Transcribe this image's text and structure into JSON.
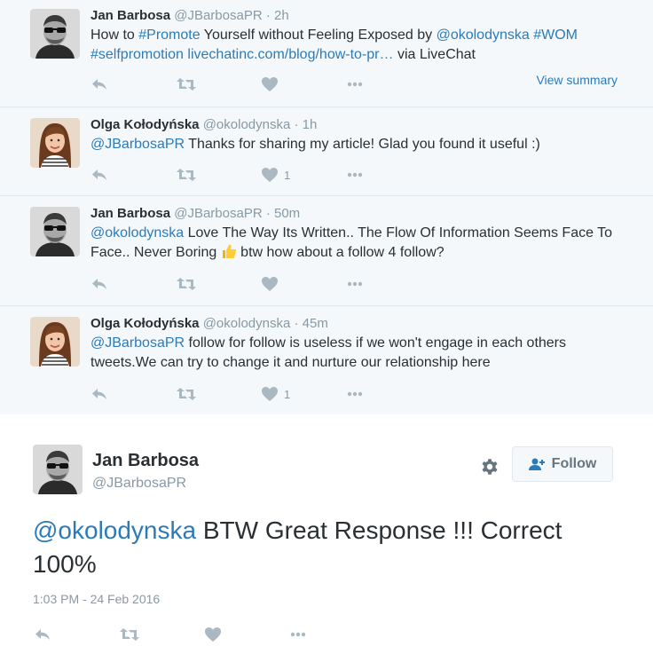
{
  "thread": [
    {
      "name": "Jan Barbosa",
      "handle": "@JBarbosaPR",
      "time": "· 2h",
      "text_parts": [
        "How to ",
        "#Promote",
        " Yourself without Feeling Exposed by ",
        "@okolodynska",
        " ",
        "#WOM",
        "#selfpromotion",
        " ",
        "livechatinc.com/blog/how-to-pr…",
        " via LiveChat"
      ],
      "view_summary": "View summary",
      "like_count": ""
    },
    {
      "name": "Olga Kołodyńska",
      "handle": "@okolodynska",
      "time": "· 1h",
      "text_parts": [
        "@JBarbosaPR",
        " Thanks for sharing my article! Glad you found it useful :)"
      ],
      "like_count": "1"
    },
    {
      "name": "Jan Barbosa",
      "handle": "@JBarbosaPR",
      "time": "· 50m",
      "text_parts": [
        "@okolodynska",
        " Love The Way Its Written.. The Flow Of Information Seems Face To Face.. Never Boring ",
        " btw how about a follow 4 follow?"
      ],
      "like_count": ""
    },
    {
      "name": "Olga Kołodyńska",
      "handle": "@okolodynska",
      "time": "· 45m",
      "text_parts": [
        "@JBarbosaPR",
        " follow for follow is useless if we won't engage in each others tweets.We can try to change it and nurture our relationship here"
      ],
      "like_count": "1"
    }
  ],
  "main_tweet": {
    "name": "Jan Barbosa",
    "handle": "@JBarbosaPR",
    "follow_label": "Follow",
    "mention": "@okolodynska",
    "text": " BTW Great Response !!! Correct 100%",
    "datetime": "1:03 PM - 24 Feb 2016"
  },
  "icons": [
    "reply-icon",
    "retweet-icon",
    "like-icon",
    "more-icon",
    "gear-icon",
    "follow-user-icon",
    "thumbs-up-emoji"
  ],
  "colors": {
    "link": "#2b7bb9",
    "muted": "#8899a6",
    "action": "#aab8c2",
    "thread_bg": "#f5f8fa"
  }
}
